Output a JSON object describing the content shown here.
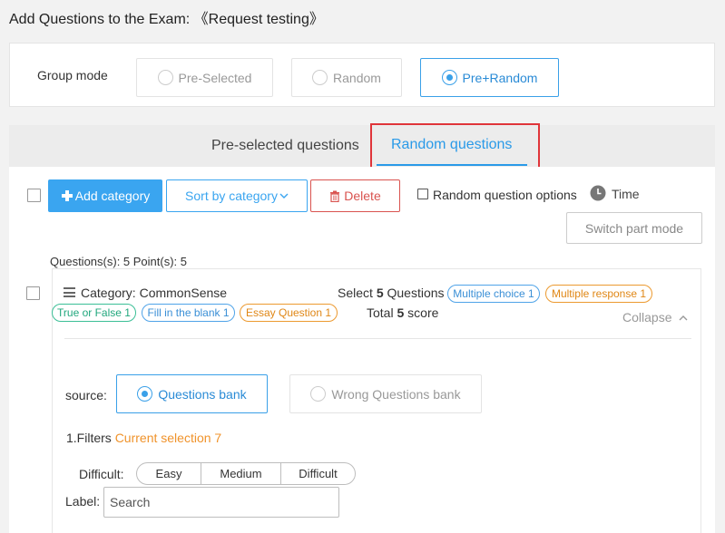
{
  "page": {
    "title": "Add Questions to the Exam: 《Request testing》"
  },
  "group_mode": {
    "label": "Group mode",
    "options": [
      {
        "label": "Pre-Selected",
        "selected": false
      },
      {
        "label": "Random",
        "selected": false
      },
      {
        "label": "Pre+Random",
        "selected": true
      }
    ]
  },
  "tabs": [
    {
      "label": "Pre-selected questions",
      "active": false
    },
    {
      "label": "Random questions",
      "active": true
    }
  ],
  "toolbar": {
    "add_category": "Add category",
    "sort_by_category": "Sort by category",
    "delete": "Delete",
    "random_question_options": "Random question options",
    "time": "Time",
    "switch_part_mode": "Switch part mode"
  },
  "summary": "Questions(s): 5 Point(s): 5",
  "category": {
    "name": "Category: CommonSense",
    "select_prefix": "Select ",
    "select_count": "5",
    "select_suffix": " Questions",
    "total_prefix": "Total ",
    "total_count": "5",
    "total_suffix": " score",
    "tags": [
      {
        "label": "Multiple choice 1",
        "color": "#4fa3e8"
      },
      {
        "label": "Multiple response 1",
        "color": "#ec9a30"
      },
      {
        "label": "True or False 1",
        "color": "#3bbf96"
      },
      {
        "label": "Fill in the blank 1",
        "color": "#4fa3e8"
      },
      {
        "label": "Essay Question 1",
        "color": "#ec9a30"
      }
    ],
    "collapse": "Collapse",
    "source": {
      "label": "source:",
      "options": [
        {
          "label": "Questions bank",
          "selected": true
        },
        {
          "label": "Wrong Questions bank",
          "selected": false
        }
      ]
    },
    "filters": {
      "title": "1.Filters",
      "current_selection": "Current selection 7",
      "difficulty_label": "Difficult:",
      "difficulty_options": [
        "Easy",
        "Medium",
        "Difficult"
      ],
      "label_label": "Label:",
      "search_placeholder": "Search"
    }
  },
  "colors": {
    "primary": "#3aa5f0",
    "danger": "#d9534f",
    "highlight_box": "#e0353a",
    "accent_orange": "#f0932b"
  }
}
